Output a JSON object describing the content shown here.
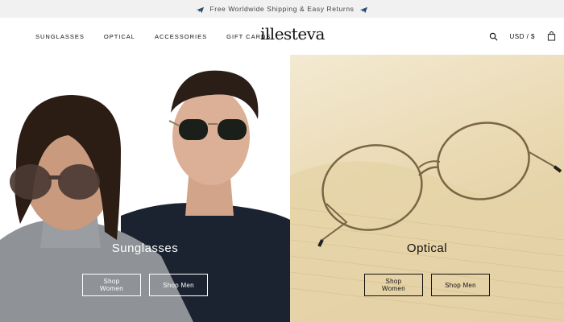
{
  "promo": {
    "text": "Free Worldwide Shipping & Easy Returns",
    "icon": "airplane-icon"
  },
  "nav": {
    "items": [
      "SUNGLASSES",
      "OPTICAL",
      "ACCESSORIES",
      "GIFT CARDS"
    ]
  },
  "brand": {
    "logo": "illesteva"
  },
  "header_right": {
    "search_icon": "search-icon",
    "currency": "USD / $",
    "bag_icon": "shopping-bag-icon"
  },
  "panels": {
    "sunglasses": {
      "title": "Sunglasses",
      "buttons": [
        "Shop Women",
        "Shop Men"
      ]
    },
    "optical": {
      "title": "Optical",
      "buttons": [
        "Shop Women",
        "Shop Men"
      ]
    }
  },
  "colors": {
    "promo_bg": "#f1f1f1",
    "optical_bg": "#ead9b2",
    "text": "#111111"
  }
}
